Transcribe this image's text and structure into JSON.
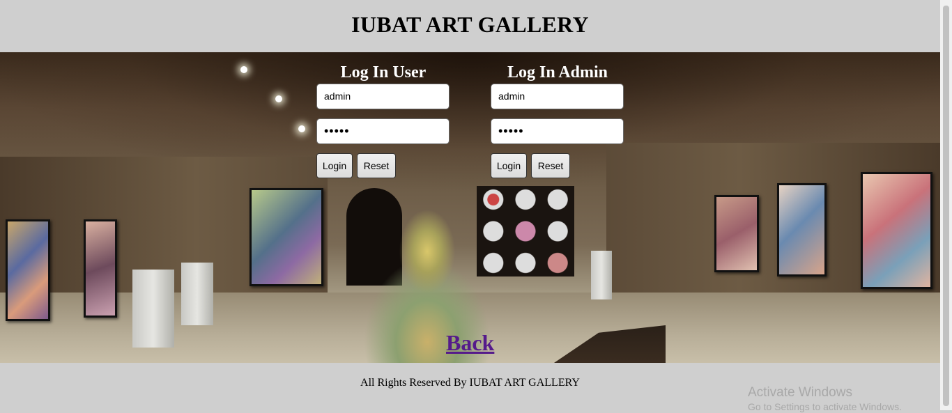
{
  "header": {
    "title": "IUBAT ART GALLERY"
  },
  "user_login": {
    "heading": "Log In User",
    "username_value": "admin",
    "password_value": "•••••",
    "login_label": "Login",
    "reset_label": "Reset"
  },
  "admin_login": {
    "heading": "Log In Admin",
    "username_value": "admin",
    "password_value": "•••••",
    "login_label": "Login",
    "reset_label": "Reset"
  },
  "back_link": "Back",
  "footer": {
    "text": "All Rights Reserved By IUBAT ART GALLERY"
  },
  "watermark": {
    "line1": "Activate Windows",
    "line2": "Go to Settings to activate Windows."
  },
  "colors": {
    "page_background": "#cfcfcf",
    "back_link": "#551a8b",
    "heading_text": "#ffffff"
  }
}
